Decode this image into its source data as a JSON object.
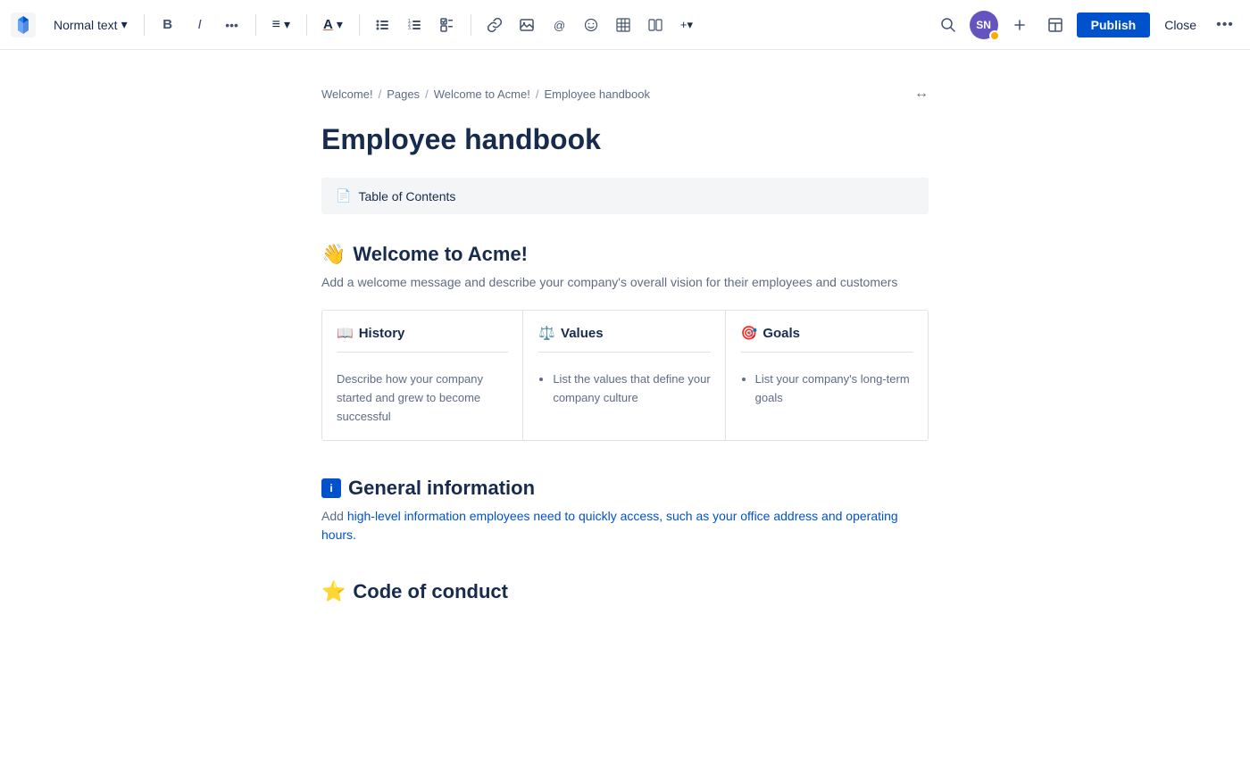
{
  "toolbar": {
    "logo_symbol": "✕",
    "text_style_label": "Normal text",
    "text_style_arrow": "▾",
    "bold_label": "B",
    "italic_label": "I",
    "more_label": "•••",
    "align_label": "≡",
    "align_arrow": "▾",
    "font_color_label": "A",
    "font_color_arrow": "▾",
    "bullet_list_label": "☰",
    "numbered_list_label": "≡",
    "task_label": "☑",
    "link_label": "🔗",
    "image_label": "🖼",
    "mention_label": "@",
    "emoji_label": "😊",
    "table_label": "⊞",
    "layout_label": "⊟",
    "insert_label": "+▾",
    "search_label": "🔍",
    "avatar_initials": "SN",
    "add_label": "+",
    "template_label": "📄",
    "publish_label": "Publish",
    "close_label": "Close",
    "overflow_label": "•••"
  },
  "breadcrumb": {
    "items": [
      "Welcome!",
      "Pages",
      "Welcome to Acme!",
      "Employee handbook"
    ],
    "separators": [
      "/",
      "/",
      "/"
    ],
    "expand_icon": "↔"
  },
  "page": {
    "title": "Employee handbook"
  },
  "toc": {
    "icon": "📄",
    "label": "Table of Contents"
  },
  "sections": [
    {
      "id": "welcome",
      "emoji": "👋",
      "heading": "Welcome to Acme!",
      "subtext": "Add a welcome message and describe your company's overall vision for their employees and customers",
      "cards": [
        {
          "emoji": "📖",
          "title": "History",
          "body_text": "Describe how your company started and grew to become successful",
          "body_type": "text"
        },
        {
          "emoji": "⚖️",
          "title": "Values",
          "bullets": [
            "List the values that define your company culture"
          ],
          "body_type": "list"
        },
        {
          "emoji": "🎯",
          "title": "Goals",
          "bullets": [
            "List your company's long-term goals"
          ],
          "body_type": "list"
        }
      ]
    },
    {
      "id": "general",
      "emoji": "ℹ️",
      "heading": "General information",
      "subtext_before": "Add ",
      "subtext_link": "high-level information employees need to quickly access, such as your office address and operating hours.",
      "subtext_after": "",
      "has_link": true
    },
    {
      "id": "conduct",
      "emoji": "⭐",
      "heading": "Code of conduct",
      "subtext": ""
    }
  ]
}
